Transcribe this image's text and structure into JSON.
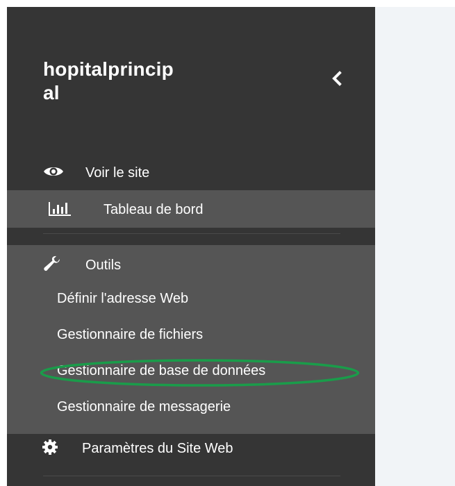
{
  "sidebar": {
    "site_name": "hopitalprincipal",
    "site_name_line1": "hopitalprincip",
    "site_name_line2": "al",
    "collapse_icon": "chevron-left-icon",
    "view_site": {
      "label": "Voir le site",
      "icon": "eye-icon"
    },
    "dashboard": {
      "label": "Tableau de bord",
      "icon": "bar-chart-icon",
      "active": true
    },
    "tools": {
      "label": "Outils",
      "icon": "wrench-icon",
      "items": [
        {
          "label": "Définir l'adresse Web"
        },
        {
          "label": "Gestionnaire de fichiers"
        },
        {
          "label": "Gestionnaire de base de données",
          "highlighted": true
        },
        {
          "label": "Gestionnaire de messagerie"
        }
      ]
    },
    "settings": {
      "label": "Paramètres du Site Web",
      "icon": "gear-icon"
    }
  },
  "colors": {
    "sidebar_bg": "#353535",
    "active_bg": "#555555",
    "content_bg": "#f1f4f7",
    "highlight": "#1a9c4a",
    "text": "#ffffff"
  }
}
